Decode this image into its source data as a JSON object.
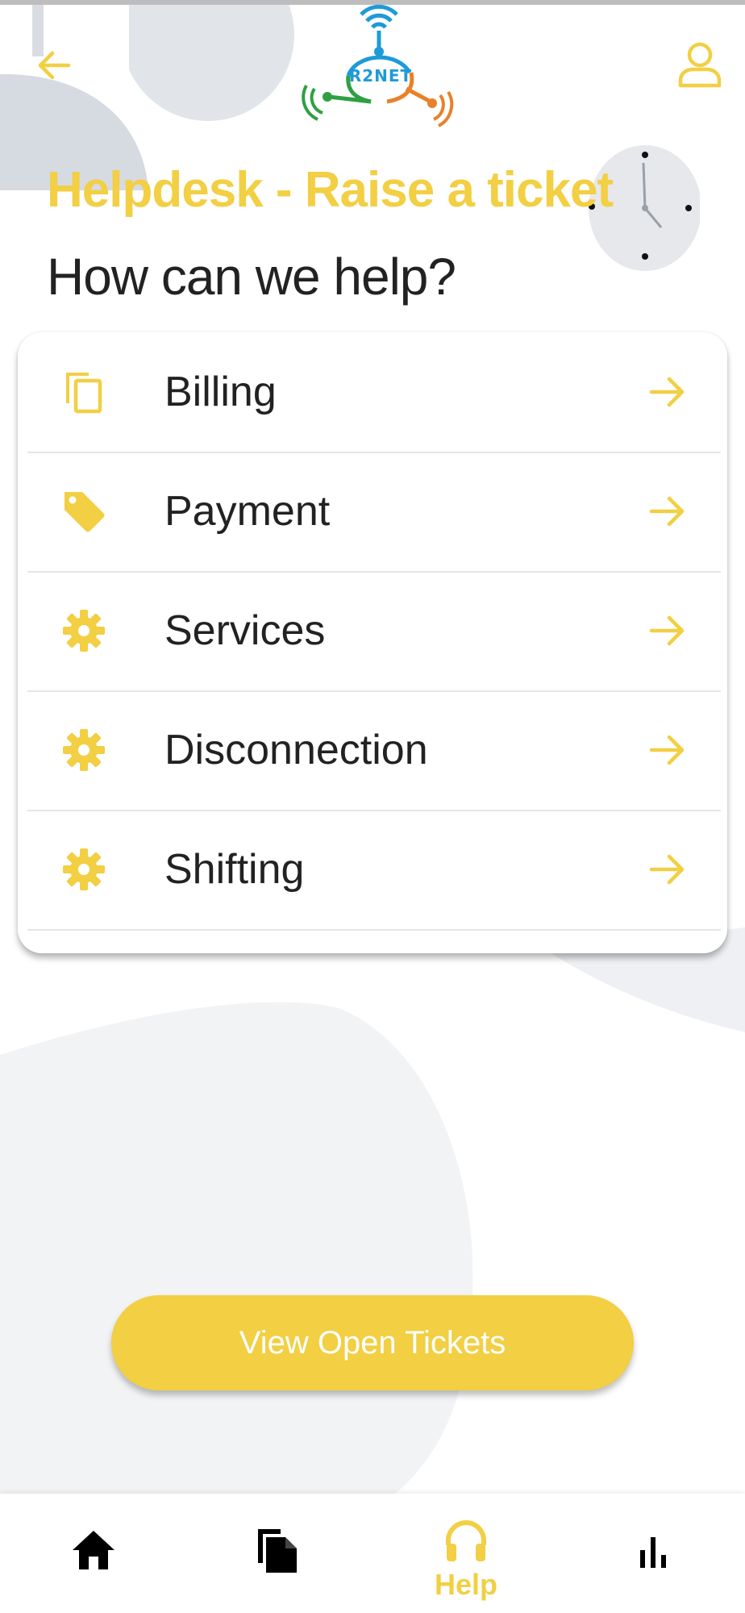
{
  "header": {
    "logo_text": "R2NET",
    "back_icon": "arrow-left-icon",
    "profile_icon": "user-icon"
  },
  "page": {
    "title": "Helpdesk - Raise a ticket",
    "subtitle": "How can we help?"
  },
  "menu": {
    "items": [
      {
        "label": "Billing",
        "icon": "copy-icon"
      },
      {
        "label": "Payment",
        "icon": "tag-icon"
      },
      {
        "label": "Services",
        "icon": "gear-icon"
      },
      {
        "label": "Disconnection",
        "icon": "gear-icon"
      },
      {
        "label": "Shifting",
        "icon": "gear-icon"
      }
    ]
  },
  "actions": {
    "view_open_tickets": "View Open Tickets"
  },
  "bottom_nav": {
    "items": [
      {
        "icon": "home-icon",
        "label": ""
      },
      {
        "icon": "documents-icon",
        "label": ""
      },
      {
        "icon": "headphones-icon",
        "label": "Help",
        "active": true
      },
      {
        "icon": "bar-chart-icon",
        "label": ""
      }
    ]
  },
  "colors": {
    "accent": "#f2cf43",
    "text": "#222222",
    "background_shape": "#e6e8ec",
    "logo_blue": "#1f9ad8",
    "logo_green": "#2ea043",
    "logo_orange": "#e8812a"
  }
}
